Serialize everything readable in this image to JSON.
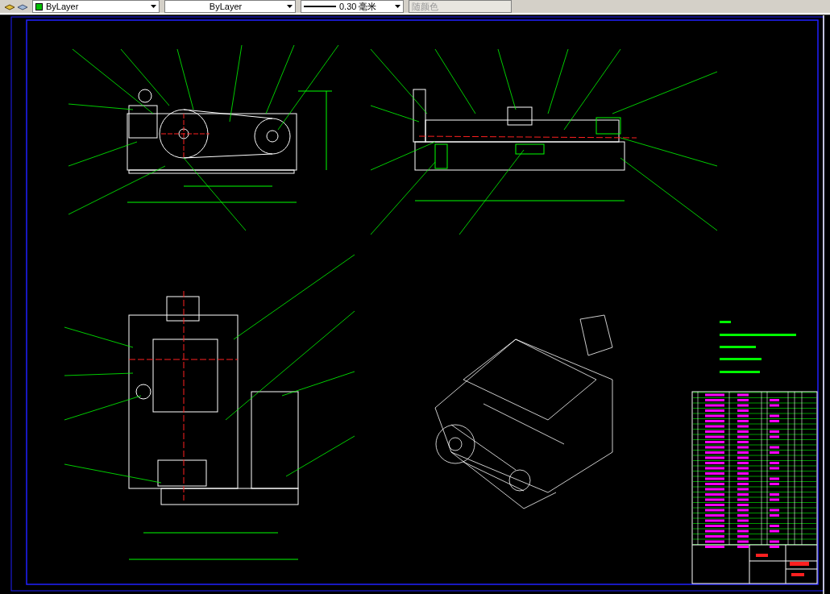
{
  "toolbar": {
    "combos": [
      {
        "kind": "color",
        "value": "ByLayer",
        "disabled": false
      },
      {
        "kind": "linetype",
        "value": "ByLayer",
        "disabled": false
      },
      {
        "kind": "lineweight",
        "value": "0.30 毫米",
        "disabled": false
      },
      {
        "kind": "plotstyle",
        "value": "随颜色",
        "disabled": true
      }
    ]
  }
}
